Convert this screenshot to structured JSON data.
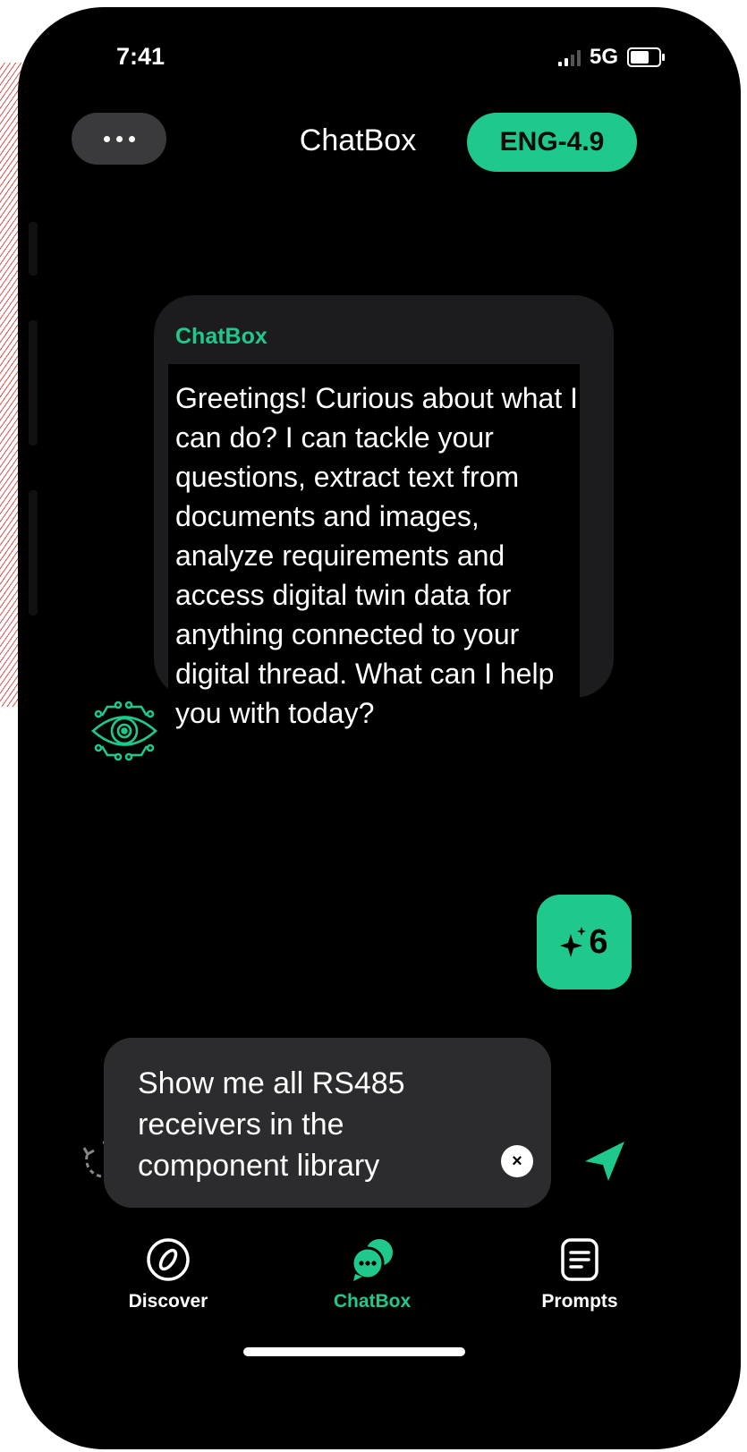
{
  "status_bar": {
    "time": "7:41",
    "network": "5G"
  },
  "header": {
    "menu_icon": "ellipsis-icon",
    "title": "ChatBox",
    "model_badge": "ENG-4.9"
  },
  "message": {
    "sender": "ChatBox",
    "text": "Greetings! Curious about what I can do? I can tackle your questions, extract text from documents and images, analyze requirements and access digital twin data for anything connected to your digital thread. What can I help you with today?",
    "avatar_icon": "eye-circuit-icon"
  },
  "credits": {
    "icon": "sparkle-icon",
    "count": "6"
  },
  "composer": {
    "text": "Show me all RS485 receivers in the component library",
    "clear_icon": "close-icon",
    "history_icon": "history-icon",
    "send_icon": "send-icon"
  },
  "bottom_nav": {
    "items": [
      {
        "label": "Discover",
        "icon": "compass-icon",
        "active": false
      },
      {
        "label": "ChatBox",
        "icon": "chat-bubbles-icon",
        "active": true
      },
      {
        "label": "Prompts",
        "icon": "document-icon",
        "active": false
      }
    ]
  },
  "colors": {
    "accent": "#1fc98c",
    "background": "#000000",
    "surface": "#1c1c1e",
    "input": "#2c2c2e"
  }
}
